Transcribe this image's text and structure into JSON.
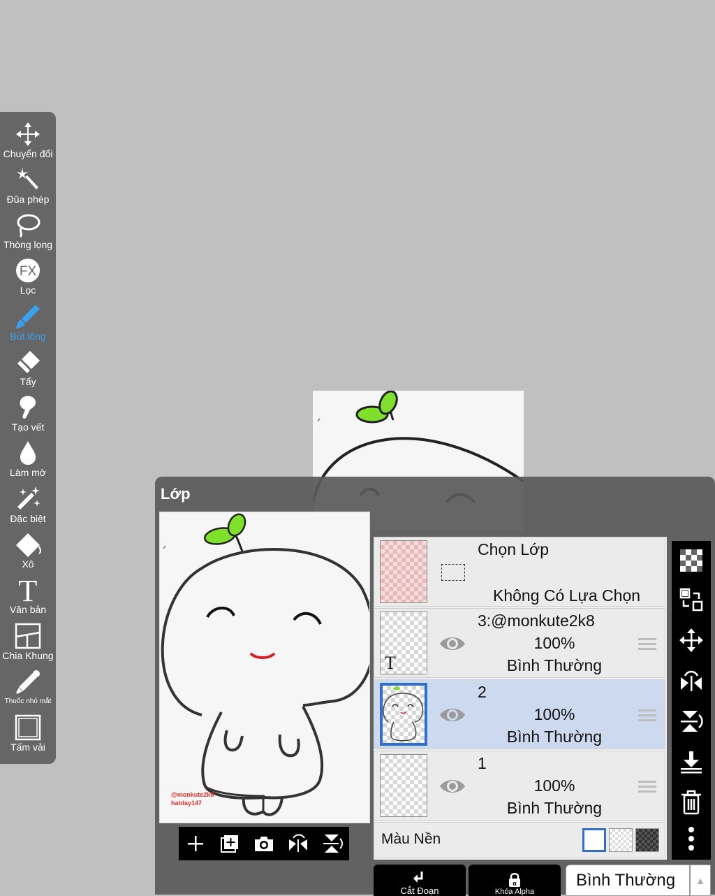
{
  "toolbar": {
    "items": [
      {
        "label": "Chuyển đổi",
        "icon": "move-arrows-icon"
      },
      {
        "label": "Đũa phép",
        "icon": "magic-wand-icon"
      },
      {
        "label": "Thòng lọng",
        "icon": "lasso-icon"
      },
      {
        "label": "Lọc",
        "icon": "fx-filter-icon"
      },
      {
        "label": "Bút lông",
        "icon": "brush-icon",
        "active": true
      },
      {
        "label": "Tẩy",
        "icon": "eraser-icon"
      },
      {
        "label": "Tạo vết",
        "icon": "smudge-icon"
      },
      {
        "label": "Làm mờ",
        "icon": "blur-drop-icon"
      },
      {
        "label": "Đặc biệt",
        "icon": "special-wand-icon"
      },
      {
        "label": "Xô",
        "icon": "bucket-icon"
      },
      {
        "label": "Văn bản",
        "icon": "text-icon"
      },
      {
        "label": "Chia Khung",
        "icon": "frame-divider-icon"
      },
      {
        "label": "Thuốc nhỏ mắt",
        "icon": "eyedropper-icon"
      },
      {
        "label": "Tấm vải",
        "icon": "canvas-icon"
      }
    ],
    "active_color": "#3aa0f0"
  },
  "layer_panel": {
    "title": "Lớp",
    "selection_row": {
      "title": "Chọn Lớp",
      "status": "Không Có Lựa Chọn"
    },
    "layers": [
      {
        "name": "3:@monkute2k8",
        "opacity": "100%",
        "blend": "Bình Thường",
        "selected": false,
        "type": "text",
        "thumb_text": "T"
      },
      {
        "name": "2",
        "opacity": "100%",
        "blend": "Bình Thường",
        "selected": true,
        "type": "drawing"
      },
      {
        "name": "1",
        "opacity": "100%",
        "blend": "Bình Thường",
        "selected": false,
        "type": "empty"
      }
    ],
    "background": {
      "label": "Màu Nền"
    },
    "watermark": {
      "line1": "@monkute2k8",
      "line2": "hatday147"
    },
    "bottom": {
      "clip_label": "Cắt Đoạn",
      "alpha_lock_label": "Khóa Alpha",
      "blend_mode": "Bình Thường",
      "arrow": "▲"
    },
    "accent_color": "#2e6fd0"
  }
}
